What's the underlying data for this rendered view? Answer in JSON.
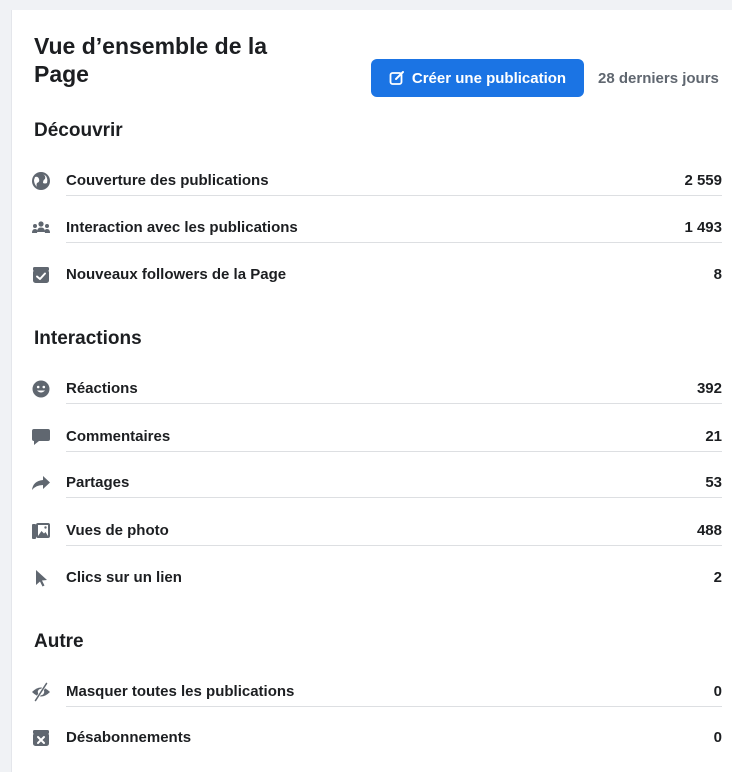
{
  "header": {
    "title": "Vue d’ensemble de la Page",
    "create_button": "Créer une publication",
    "range": "28 derniers jours"
  },
  "sections": {
    "discover": {
      "title": "Découvrir",
      "items": [
        {
          "label": "Couverture des publications",
          "value": "2 559",
          "icon": "globe-icon"
        },
        {
          "label": "Interaction avec les publications",
          "value": "1 493",
          "icon": "people-icon"
        },
        {
          "label": "Nouveaux followers de la Page",
          "value": "8",
          "icon": "follower-check-icon"
        }
      ]
    },
    "interactions": {
      "title": "Interactions",
      "items": [
        {
          "label": "Réactions",
          "value": "392",
          "icon": "smiley-icon"
        },
        {
          "label": "Commentaires",
          "value": "21",
          "icon": "comment-icon"
        },
        {
          "label": "Partages",
          "value": "53",
          "icon": "share-arrow-icon"
        },
        {
          "label": "Vues de photo",
          "value": "488",
          "icon": "photo-icon"
        },
        {
          "label": "Clics sur un lien",
          "value": "2",
          "icon": "cursor-icon"
        }
      ]
    },
    "other": {
      "title": "Autre",
      "items": [
        {
          "label": "Masquer toutes les publications",
          "value": "0",
          "icon": "eye-slash-icon"
        },
        {
          "label": "Désabonnements",
          "value": "0",
          "icon": "unsubscribe-icon"
        }
      ]
    }
  },
  "colors": {
    "accent": "#1b74e4",
    "icon": "#606770"
  }
}
